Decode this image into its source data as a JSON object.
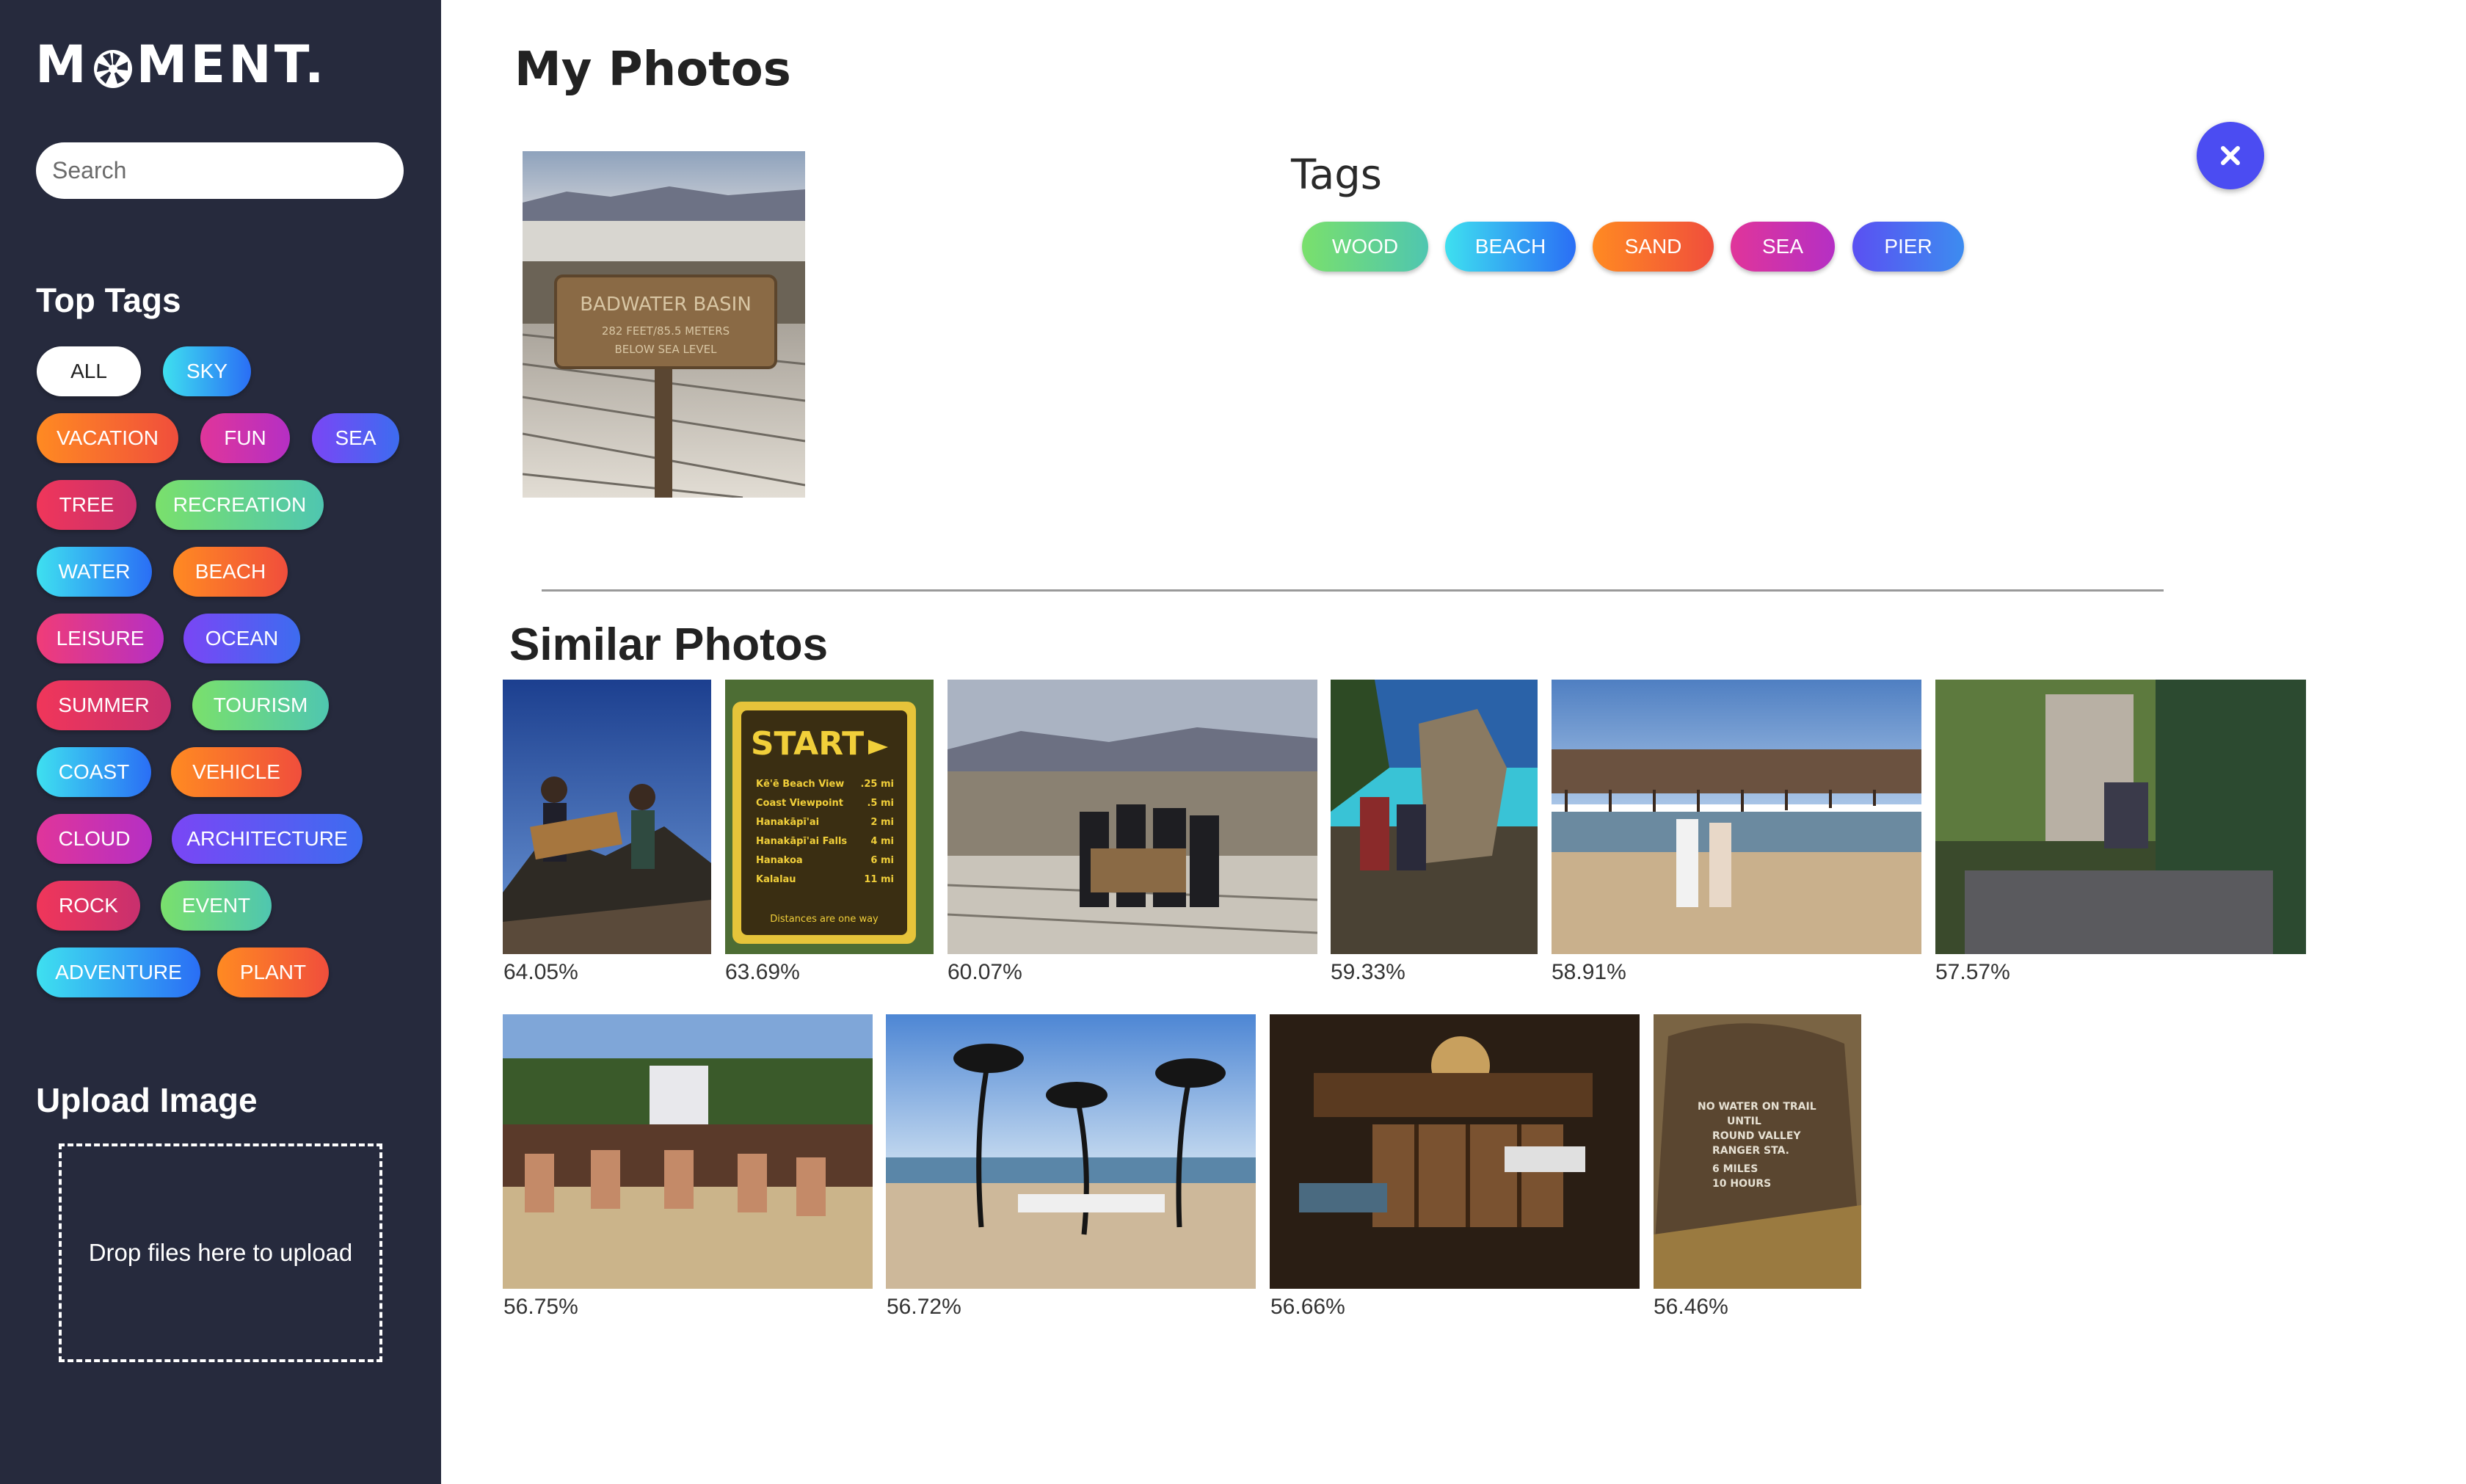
{
  "app": {
    "logo_text_left": "M",
    "logo_text_right": "MENT."
  },
  "search": {
    "placeholder": "Search"
  },
  "sidebar": {
    "top_tags_title": "Top Tags",
    "tags": [
      "ALL",
      "SKY",
      "VACATION",
      "FUN",
      "SEA",
      "TREE",
      "RECREATION",
      "WATER",
      "BEACH",
      "LEISURE",
      "OCEAN",
      "SUMMER",
      "TOURISM",
      "COAST",
      "VEHICLE",
      "CLOUD",
      "ARCHITECTURE",
      "ROCK",
      "EVENT",
      "ADVENTURE",
      "PLANT"
    ],
    "upload_title": "Upload Image",
    "dropzone_text": "Drop files here to upload"
  },
  "main": {
    "title": "My Photos",
    "tags_title": "Tags",
    "photo_tags": [
      "WOOD",
      "BEACH",
      "SAND",
      "SEA",
      "PIER"
    ],
    "similar_title": "Similar Photos",
    "similar": [
      {
        "score": "64.05%"
      },
      {
        "score": "63.69%"
      },
      {
        "score": "60.07%"
      },
      {
        "score": "59.33%"
      },
      {
        "score": "58.91%"
      },
      {
        "score": "57.57%"
      },
      {
        "score": "56.75%"
      },
      {
        "score": "56.72%"
      },
      {
        "score": "56.66%"
      },
      {
        "score": "56.46%"
      }
    ],
    "main_photo_sign": {
      "line1": "BADWATER BASIN",
      "line2": "282 FEET/85.5 METERS",
      "line3": "BELOW SEA LEVEL"
    },
    "start_sign": {
      "title": "START",
      "rows": [
        [
          "Kē'ē Beach View",
          ".25 mi"
        ],
        [
          "Coast Viewpoint",
          ".5 mi"
        ],
        [
          "Hanakāpī'ai",
          "2 mi"
        ],
        [
          "Hanakāpī'ai Falls",
          "4 mi"
        ],
        [
          "Hanakoa",
          "6 mi"
        ],
        [
          "Kalalau",
          "11 mi"
        ]
      ],
      "footer": "Distances are one way"
    },
    "rock_text": {
      "line1": "NO WATER ON TRAIL",
      "line2": "UNTIL",
      "line3": "ROUND VALLEY",
      "line4": "RANGER STA.",
      "line5": "6 MILES",
      "line6": "10 HOURS"
    }
  },
  "colors": {
    "sidebar_bg": "#262a3d",
    "close_button": "#4b4cf2",
    "tag_gradients": {
      "sky": [
        "#3ee0f0",
        "#2a6ef5"
      ],
      "orange": [
        "#ff8a22",
        "#f04e3c"
      ],
      "magenta": [
        "#e0359a",
        "#b52fc4"
      ],
      "violet": [
        "#7a46f5",
        "#3d6cf0"
      ],
      "red": [
        "#f0365a",
        "#c8306e"
      ],
      "green": [
        "#7ae06c",
        "#4fc6b0"
      ],
      "pink": [
        "#f03c78",
        "#d22d96"
      ],
      "purple": [
        "#5a50f2",
        "#9b3fe6"
      ]
    }
  }
}
